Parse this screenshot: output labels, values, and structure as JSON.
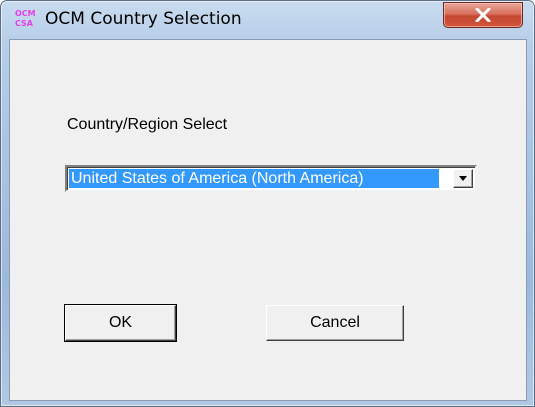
{
  "window": {
    "title": "OCM Country Selection",
    "icon_text": [
      "OCM",
      "CSA"
    ],
    "close_glyph": "close-x-icon"
  },
  "form": {
    "region_label": "Country/Region Select",
    "region_select": {
      "selected_value": "United States of America (North America)"
    }
  },
  "buttons": {
    "ok_label": "OK",
    "cancel_label": "Cancel"
  },
  "colors": {
    "selection_highlight": "#3399ff",
    "close_button": "#c4472f",
    "icon_text": "#e040e8",
    "dialog_face": "#f0f0f0"
  }
}
